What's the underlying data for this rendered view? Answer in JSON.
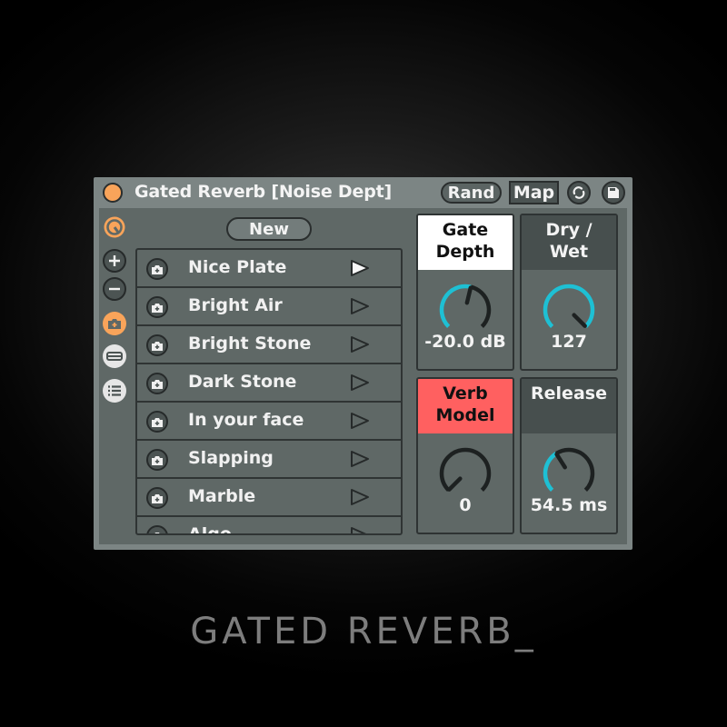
{
  "device": {
    "title": "Gated Reverb [Noise Dept]",
    "buttons": {
      "rand": "Rand",
      "map": "Map"
    },
    "colors": {
      "accent_orange": "#f9a45a",
      "knob_arc": "#1ec0d4",
      "alert_red": "#ff6060",
      "panel": "#5f6866",
      "frame": "#7c8584"
    }
  },
  "sidebar": {
    "icons": [
      "hot-swap-icon",
      "add-icon",
      "remove-icon",
      "snapshot-icon",
      "collapse-icon",
      "list-icon"
    ]
  },
  "presets": {
    "new_label": "New",
    "items": [
      {
        "name": "Nice Plate",
        "active": true
      },
      {
        "name": "Bright Air",
        "active": false
      },
      {
        "name": "Bright Stone",
        "active": false
      },
      {
        "name": "Dark Stone",
        "active": false
      },
      {
        "name": "In your face",
        "active": false
      },
      {
        "name": "Slapping",
        "active": false
      },
      {
        "name": "Marble",
        "active": false
      },
      {
        "name": "Algo",
        "active": false
      }
    ]
  },
  "knobs": [
    {
      "label_line1": "Gate",
      "label_line2": "Depth",
      "value": "-20.0 dB",
      "fraction": 0.55,
      "head_style": "selected"
    },
    {
      "label_line1": "Dry /",
      "label_line2": "Wet",
      "value": "127",
      "fraction": 1.0,
      "head_style": "normal"
    },
    {
      "label_line1": "Verb",
      "label_line2": "Model",
      "value": "0",
      "fraction": 0.0,
      "head_style": "alert"
    },
    {
      "label_line1": "Release",
      "label_line2": "",
      "value": "54.5 ms",
      "fraction": 0.38,
      "head_style": "normal"
    }
  ],
  "caption": "GATED REVERB_"
}
